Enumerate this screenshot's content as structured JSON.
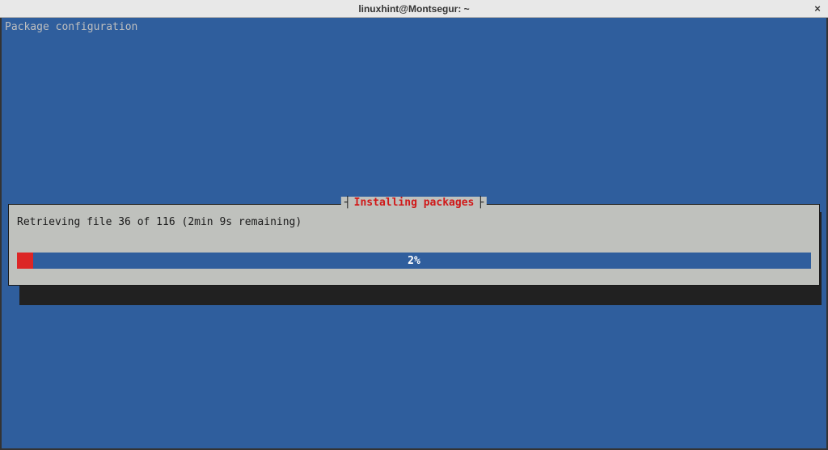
{
  "window": {
    "title": "linuxhint@Montsegur: ~",
    "close_icon": "×"
  },
  "terminal": {
    "header": "Package configuration"
  },
  "dialog": {
    "title_deco_left": "┤",
    "title_deco_right": "├",
    "title": "Installing packages",
    "status": "Retrieving file 36 of 116 (2min 9s remaining)",
    "progress_percent": 2,
    "progress_label": "2%"
  },
  "colors": {
    "terminal_bg": "#2f5e9d",
    "dialog_bg": "#bfc1bd",
    "accent_red": "#dc2626"
  }
}
